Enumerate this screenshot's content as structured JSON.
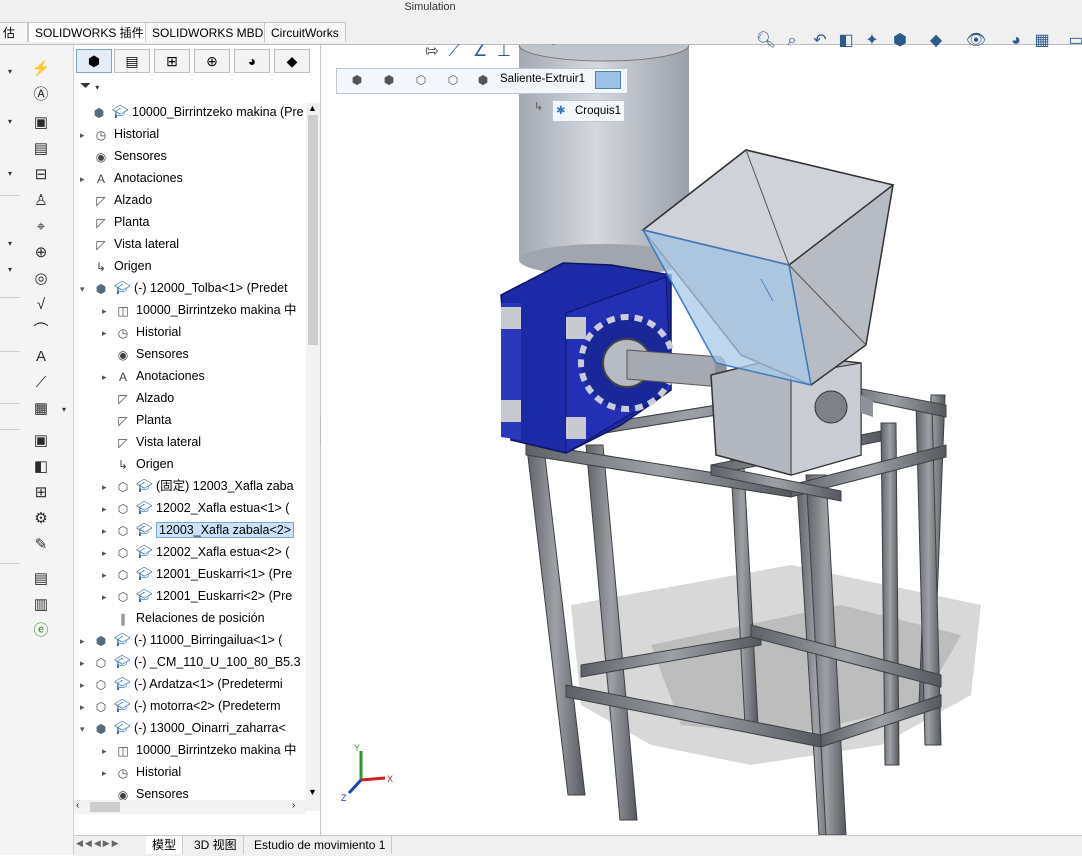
{
  "app": {
    "title": "Simulation"
  },
  "tabs": [
    "估",
    "SOLIDWORKS 插件",
    "SOLIDWORKS MBD",
    "CircuitWorks"
  ],
  "tree": [
    {
      "label": "10000_Birrintzeko makina  (Pre",
      "level": 0,
      "icon": "assembly-icon"
    },
    {
      "label": "Historial",
      "level": 1,
      "icon": "history-icon"
    },
    {
      "label": "Sensores",
      "level": 1,
      "icon": "sensor-icon"
    },
    {
      "label": "Anotaciones",
      "level": 1,
      "icon": "annotation-icon"
    },
    {
      "label": "Alzado",
      "level": 1,
      "icon": "plane-icon"
    },
    {
      "label": "Planta",
      "level": 1,
      "icon": "plane-icon"
    },
    {
      "label": "Vista lateral",
      "level": 1,
      "icon": "plane-icon"
    },
    {
      "label": "Origen",
      "level": 1,
      "icon": "origin-icon"
    },
    {
      "label": "(-) 12000_Tolba<1> (Predet",
      "level": 1,
      "icon": "subassembly-icon"
    },
    {
      "label": "10000_Birrintzeko makina 中",
      "level": 2,
      "icon": "assembly-ref-icon"
    },
    {
      "label": "Historial",
      "level": 2,
      "icon": "history-icon"
    },
    {
      "label": "Sensores",
      "level": 2,
      "icon": "sensor-icon"
    },
    {
      "label": "Anotaciones",
      "level": 2,
      "icon": "annotation-icon"
    },
    {
      "label": "Alzado",
      "level": 2,
      "icon": "plane-icon"
    },
    {
      "label": "Planta",
      "level": 2,
      "icon": "plane-icon"
    },
    {
      "label": "Vista lateral",
      "level": 2,
      "icon": "plane-icon"
    },
    {
      "label": "Origen",
      "level": 2,
      "icon": "origin-icon"
    },
    {
      "label": "(固定) 12003_Xafla zaba",
      "level": 2,
      "icon": "part-icon"
    },
    {
      "label": "12002_Xafla estua<1> (",
      "level": 2,
      "icon": "part-icon"
    },
    {
      "label": "12003_Xafla zabala<2>",
      "level": 2,
      "icon": "part-icon",
      "selected": true
    },
    {
      "label": "12002_Xafla estua<2> (",
      "level": 2,
      "icon": "part-icon"
    },
    {
      "label": "12001_Euskarri<1> (Pre",
      "level": 2,
      "icon": "part-icon"
    },
    {
      "label": "12001_Euskarri<2> (Pre",
      "level": 2,
      "icon": "part-icon"
    },
    {
      "label": "Relaciones de posición",
      "level": 2,
      "icon": "mates-icon"
    },
    {
      "label": "(-) 11000_Birringailua<1> (",
      "level": 1,
      "icon": "subassembly-icon"
    },
    {
      "label": "(-) _CM_110_U_100_80_B5.3",
      "level": 1,
      "icon": "part-icon"
    },
    {
      "label": "(-) Ardatza<1> (Predetermi",
      "level": 1,
      "icon": "part-icon"
    },
    {
      "label": "(-) motorra<2> (Predeterm",
      "level": 1,
      "icon": "part-icon"
    },
    {
      "label": "(-) 13000_Oinarri_zaharra<",
      "level": 1,
      "icon": "subassembly-icon"
    },
    {
      "label": "10000_Birrintzeko makina 中",
      "level": 2,
      "icon": "assembly-ref-icon"
    },
    {
      "label": "Historial",
      "level": 2,
      "icon": "history-icon"
    },
    {
      "label": "Sensores",
      "level": 2,
      "icon": "sensor-icon"
    }
  ],
  "breadcrumb": {
    "label": "Saliente-Extruir1",
    "child": "Croquis1"
  },
  "bottom_tabs": [
    "模型",
    "3D 视图",
    "Estudio de movimiento 1"
  ],
  "triad": {
    "x": "X",
    "y": "Y",
    "z": "Z"
  },
  "colors": {
    "selection": "#cce2f9",
    "motor_blue": "#1f2ea8",
    "frame_gray": "#6f7378",
    "hopper": "#b8bcc4"
  }
}
